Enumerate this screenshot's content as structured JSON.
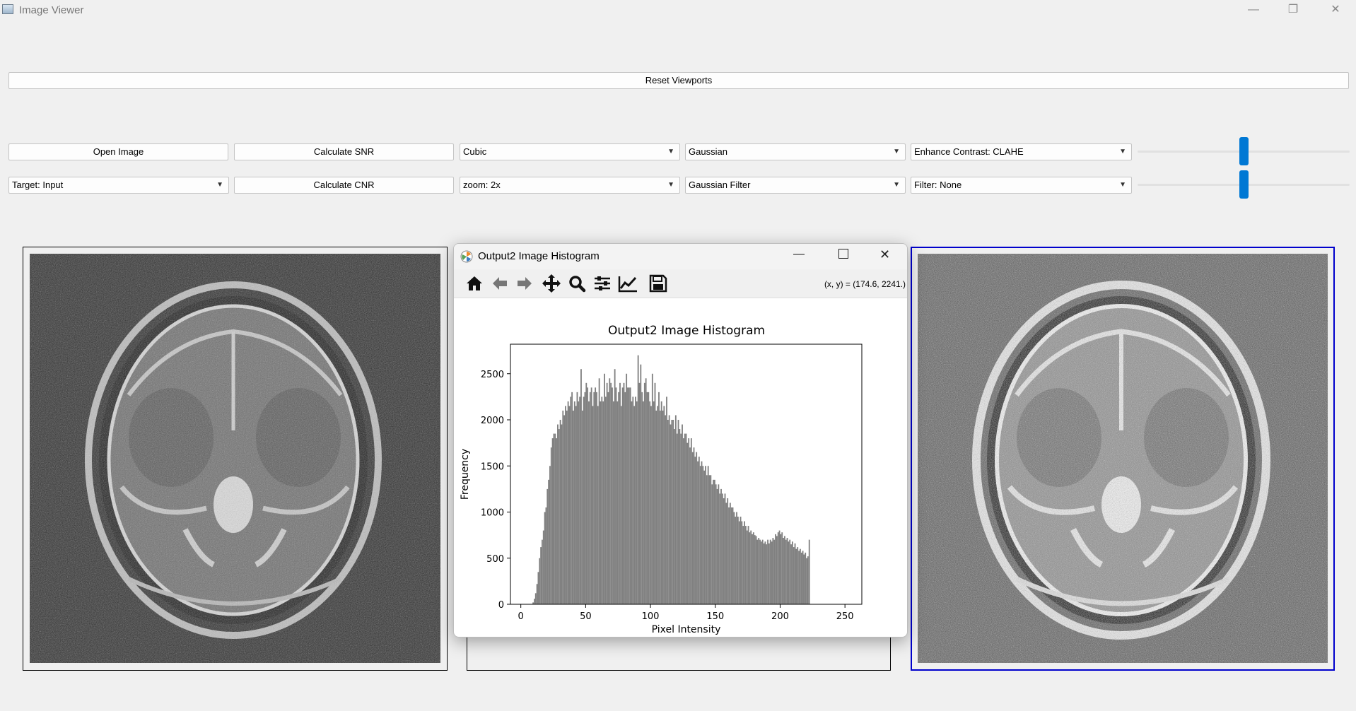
{
  "window": {
    "title": "Image Viewer",
    "minimize": "—",
    "restore": "❐",
    "close": "✕"
  },
  "toolbar": {
    "reset_label": "Reset Viewports",
    "open_label": "Open Image",
    "snr_label": "Calculate SNR",
    "cnr_label": "Calculate CNR",
    "interp_value": "Cubic",
    "noise_value": "Gaussian",
    "contrast_value": "Enhance Contrast: CLAHE",
    "target_value": "Target: Input",
    "zoom_value": "zoom: 2x",
    "noise_filter_value": "Gaussian Filter",
    "filter_value": "Filter: None",
    "slider1_fraction": 0.5,
    "slider2_fraction": 0.5
  },
  "popup": {
    "title": "Output2 Image Histogram",
    "coords": "(x, y) = (174.6, 2241.)",
    "icons": [
      "home-icon",
      "back-icon",
      "forward-icon",
      "pan-icon",
      "zoom-icon",
      "configure-subplots-icon",
      "edit-axis-icon",
      "save-icon"
    ]
  },
  "chart_data": {
    "type": "bar",
    "title": "Output2 Image Histogram",
    "xlabel": "Pixel Intensity",
    "ylabel": "Frequency",
    "xlim": [
      -8,
      263
    ],
    "ylim": [
      0,
      2820
    ],
    "xticks": [
      0,
      50,
      100,
      150,
      200,
      250
    ],
    "yticks": [
      0,
      500,
      1000,
      1500,
      2000,
      2500
    ],
    "color": "#808080",
    "bin_width": 1,
    "x_start": 0,
    "values": [
      0,
      0,
      0,
      0,
      0,
      0,
      0,
      0,
      0,
      20,
      60,
      120,
      220,
      350,
      500,
      620,
      700,
      800,
      1000,
      1050,
      1250,
      1350,
      1500,
      1700,
      1800,
      1850,
      1850,
      1800,
      1950,
      1900,
      2000,
      1950,
      2100,
      2050,
      2150,
      2100,
      2200,
      2150,
      2250,
      2300,
      2100,
      2200,
      2150,
      2300,
      2200,
      2250,
      2550,
      2100,
      2250,
      2300,
      2400,
      2350,
      2200,
      2300,
      2350,
      2150,
      2300,
      2350,
      2300,
      2150,
      2450,
      2200,
      2250,
      2200,
      2500,
      2250,
      2400,
      2300,
      2450,
      2400,
      2350,
      2200,
      2550,
      2350,
      2200,
      2300,
      2400,
      2150,
      2350,
      2400,
      2300,
      2500,
      2350,
      2350,
      2350,
      2200,
      2250,
      2150,
      2250,
      2200,
      2700,
      2400,
      2600,
      2300,
      2200,
      2400,
      2450,
      2300,
      2300,
      2200,
      2150,
      2500,
      2200,
      2400,
      2100,
      2150,
      2300,
      2100,
      2200,
      2100,
      2150,
      2050,
      2250,
      2000,
      2050,
      1950,
      2000,
      2000,
      1900,
      2050,
      1850,
      2000,
      1900,
      1850,
      1950,
      1800,
      1850,
      1850,
      1750,
      1800,
      1700,
      1800,
      1650,
      1700,
      1600,
      1650,
      1550,
      1600,
      1500,
      1550,
      1500,
      1450,
      1500,
      1400,
      1500,
      1400,
      1400,
      1300,
      1350,
      1350,
      1300,
      1250,
      1300,
      1200,
      1250,
      1200,
      1150,
      1200,
      1100,
      1150,
      1050,
      1100,
      1050,
      1050,
      1000,
      950,
      1000,
      950,
      900,
      950,
      900,
      850,
      900,
      850,
      800,
      850,
      780,
      800,
      760,
      780,
      750,
      740,
      700,
      720,
      700,
      680,
      700,
      660,
      680,
      650,
      700,
      660,
      700,
      680,
      720,
      700,
      760,
      740,
      780,
      800,
      760,
      780,
      720,
      740,
      700,
      720,
      680,
      700,
      650,
      680,
      620,
      660,
      600,
      620,
      580,
      600,
      560,
      580,
      540,
      560,
      500,
      520,
      700,
      0,
      0,
      0,
      0,
      0,
      0,
      0,
      0,
      0,
      0,
      0,
      0,
      0,
      0,
      0,
      0
    ]
  }
}
